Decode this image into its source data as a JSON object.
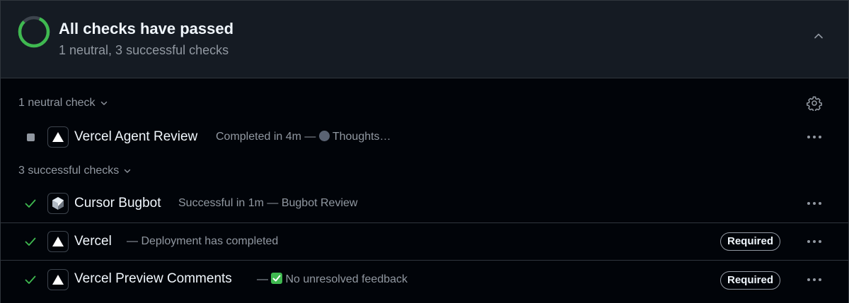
{
  "summary": {
    "title": "All checks have passed",
    "subtitle": "1 neutral, 3 successful checks",
    "icon": "progress-ring-icon"
  },
  "groups": {
    "neutral": {
      "label": "1 neutral check"
    },
    "successful": {
      "label": "3 successful checks"
    }
  },
  "checks": [
    {
      "name": "Vercel Agent Review",
      "desc_prefix": "Completed in 4m — ",
      "desc_emoji": "thinking-face-icon",
      "desc_text": "Thoughts…",
      "status": "neutral",
      "required": ""
    },
    {
      "name": "Cursor Bugbot",
      "desc_text": "Successful in 1m — Bugbot Review",
      "status": "success",
      "required": ""
    },
    {
      "name": "Vercel",
      "desc_text": "— Deployment has completed",
      "status": "success",
      "required": "Required"
    },
    {
      "name": "Vercel Preview Comments",
      "desc_prefix": "— ",
      "desc_emoji": "check-mark-button-icon",
      "desc_text": "No unresolved feedback",
      "status": "success",
      "required": "Required"
    }
  ],
  "colors": {
    "success": "#3fb950",
    "neutral": "#9198a1",
    "background": "#010409",
    "header": "#151b23"
  }
}
